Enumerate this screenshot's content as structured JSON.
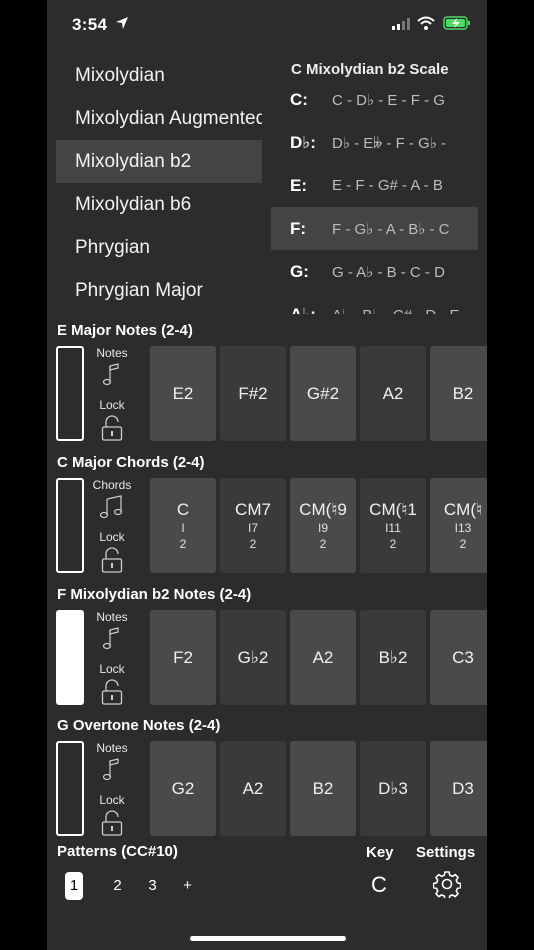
{
  "status": {
    "time": "3:54"
  },
  "scale_list": {
    "items": [
      {
        "label": "Mixolydian",
        "selected": false
      },
      {
        "label": "Mixolydian Augmented",
        "selected": false
      },
      {
        "label": "Mixolydian b2",
        "selected": true
      },
      {
        "label": "Mixolydian b6",
        "selected": false
      },
      {
        "label": "Phrygian",
        "selected": false
      },
      {
        "label": "Phrygian Major",
        "selected": false
      }
    ]
  },
  "scale_panel": {
    "title": "C Mixolydian b2 Scale",
    "degrees": [
      {
        "key": "C:",
        "notes": "C - D♭ - E - F - G"
      },
      {
        "key": "D♭:",
        "notes": "D♭ - E𝄫 - F - G♭ -"
      },
      {
        "key": "E:",
        "notes": "E - F - G# - A - B"
      },
      {
        "key": "F:",
        "notes": "F - G♭ - A - B♭ - C"
      },
      {
        "key": "G:",
        "notes": "G - A♭ - B - C - D"
      },
      {
        "key": "A♭:",
        "notes": "A♭ - B♭ - C# - D - E"
      }
    ],
    "selected_index": 3
  },
  "groups": [
    {
      "title": "E Major Notes (2-4)",
      "mode_label": "Notes",
      "lock_label": "Lock",
      "locked": false,
      "cells": [
        {
          "name": "E2",
          "sub1": "",
          "sub2": ""
        },
        {
          "name": "F#2",
          "sub1": "",
          "sub2": ""
        },
        {
          "name": "G#2",
          "sub1": "",
          "sub2": ""
        },
        {
          "name": "A2",
          "sub1": "",
          "sub2": ""
        },
        {
          "name": "B2",
          "sub1": "",
          "sub2": ""
        }
      ]
    },
    {
      "title": "C Major Chords (2-4)",
      "mode_label": "Chords",
      "lock_label": "Lock",
      "locked": false,
      "cells": [
        {
          "name": "C",
          "sub1": "I",
          "sub2": "2"
        },
        {
          "name": "CM7",
          "sub1": "I7",
          "sub2": "2"
        },
        {
          "name": "CM(♮9",
          "sub1": "I9",
          "sub2": "2"
        },
        {
          "name": "CM(♮1",
          "sub1": "I11",
          "sub2": "2"
        },
        {
          "name": "CM(♮",
          "sub1": "I13",
          "sub2": "2"
        }
      ]
    },
    {
      "title": "F Mixolydian b2 Notes (2-4)",
      "mode_label": "Notes",
      "lock_label": "Lock",
      "locked": true,
      "cells": [
        {
          "name": "F2",
          "sub1": "",
          "sub2": ""
        },
        {
          "name": "G♭2",
          "sub1": "",
          "sub2": ""
        },
        {
          "name": "A2",
          "sub1": "",
          "sub2": ""
        },
        {
          "name": "B♭2",
          "sub1": "",
          "sub2": ""
        },
        {
          "name": "C3",
          "sub1": "",
          "sub2": ""
        }
      ]
    },
    {
      "title": "G Overtone Notes (2-4)",
      "mode_label": "Notes",
      "lock_label": "Lock",
      "locked": false,
      "cells": [
        {
          "name": "G2",
          "sub1": "",
          "sub2": ""
        },
        {
          "name": "A2",
          "sub1": "",
          "sub2": ""
        },
        {
          "name": "B2",
          "sub1": "",
          "sub2": ""
        },
        {
          "name": "D♭3",
          "sub1": "",
          "sub2": ""
        },
        {
          "name": "D3",
          "sub1": "",
          "sub2": ""
        }
      ]
    }
  ],
  "footer": {
    "patterns_label": "Patterns (CC#10)",
    "pages": [
      "1",
      "2",
      "3",
      "+"
    ],
    "active_page": "1",
    "key_label": "Key",
    "key_value": "C",
    "settings_label": "Settings"
  }
}
